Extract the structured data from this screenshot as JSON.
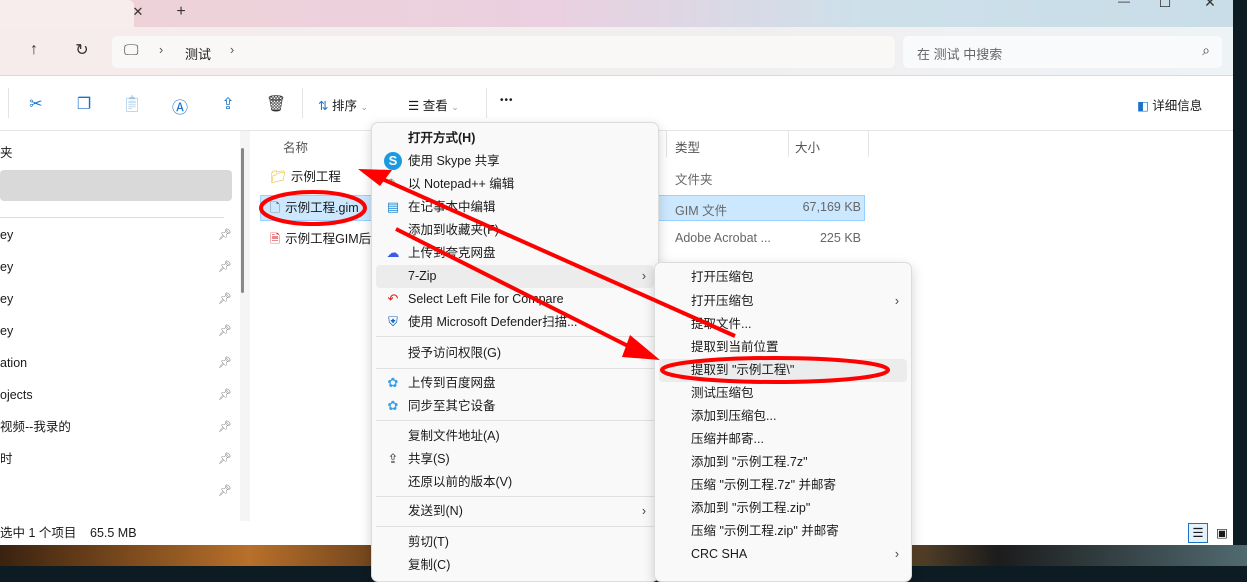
{
  "titlebar": {
    "close_tab": "✕",
    "new_tab": "+",
    "minimize": "—",
    "maximize": "☐",
    "close": "✕"
  },
  "nav": {
    "up": "↑",
    "refresh": "↻",
    "breadcrumb": [
      "测试"
    ],
    "search_placeholder": "在 测试 中搜索"
  },
  "toolbar": {
    "sort": "排序",
    "view": "查看",
    "more": "•••",
    "details": "详细信息"
  },
  "sidebar": {
    "items": [
      "夹",
      "",
      "ey",
      "ey",
      "ey",
      "ey",
      "ation",
      "ojects",
      "视频--我录的",
      "时",
      ""
    ]
  },
  "columns": {
    "name": "名称",
    "type": "类型",
    "size": "大小"
  },
  "files": [
    {
      "name": "示例工程",
      "type": "文件夹",
      "size": "",
      "icon": "folder-icon"
    },
    {
      "name": "示例工程.gim",
      "type": "GIM 文件",
      "size": "67,169 KB",
      "icon": "file-icon",
      "selected": true
    },
    {
      "name": "示例工程GIM后",
      "type": "Adobe Acrobat ...",
      "size": "225 KB",
      "icon": "pdf-icon"
    }
  ],
  "status": {
    "selection": "选中 1 个项目",
    "size": "65.5 MB"
  },
  "context_menu": {
    "items": [
      {
        "label": "打开方式(H)"
      },
      {
        "label": "使用 Skype 共享",
        "icon": "skype-icon"
      },
      {
        "label": "以 Notepad++ 编辑",
        "icon": "notepadpp-icon"
      },
      {
        "label": "在记事本中编辑",
        "icon": "notepad-icon"
      },
      {
        "label": "添加到收藏夹(F)"
      },
      {
        "label": "上传到夸克网盘",
        "icon": "quark-cloud-icon"
      },
      {
        "label": "7-Zip",
        "submenu": true
      },
      {
        "label": "Select Left File for Compare",
        "icon": "compare-icon"
      },
      {
        "label": "使用 Microsoft Defender扫描...",
        "icon": "defender-icon"
      },
      {
        "label": "授予访问权限(G)"
      },
      {
        "label": "上传到百度网盘",
        "icon": "baidu-icon"
      },
      {
        "label": "同步至其它设备",
        "icon": "baidu-icon"
      },
      {
        "label": "复制文件地址(A)"
      },
      {
        "label": "共享(S)",
        "icon": "share-icon"
      },
      {
        "label": "还原以前的版本(V)"
      },
      {
        "label": "发送到(N)",
        "submenu": true
      },
      {
        "label": "剪切(T)"
      },
      {
        "label": "复制(C)"
      }
    ]
  },
  "zip_menu": {
    "items": [
      {
        "label": "打开压缩包"
      },
      {
        "label": "打开压缩包",
        "submenu": true
      },
      {
        "label": "提取文件..."
      },
      {
        "label": "提取到当前位置"
      },
      {
        "label": "提取到 \"示例工程\\\""
      },
      {
        "label": "测试压缩包"
      },
      {
        "label": "添加到压缩包..."
      },
      {
        "label": "压缩并邮寄..."
      },
      {
        "label": "添加到 \"示例工程.7z\""
      },
      {
        "label": "压缩 \"示例工程.7z\" 并邮寄"
      },
      {
        "label": "添加到 \"示例工程.zip\""
      },
      {
        "label": "压缩 \"示例工程.zip\" 并邮寄"
      },
      {
        "label": "CRC SHA",
        "submenu": true
      }
    ]
  },
  "colors": {
    "annotation": "#ff0000",
    "accent": "#1a73c9",
    "selection": "#cce8ff"
  }
}
